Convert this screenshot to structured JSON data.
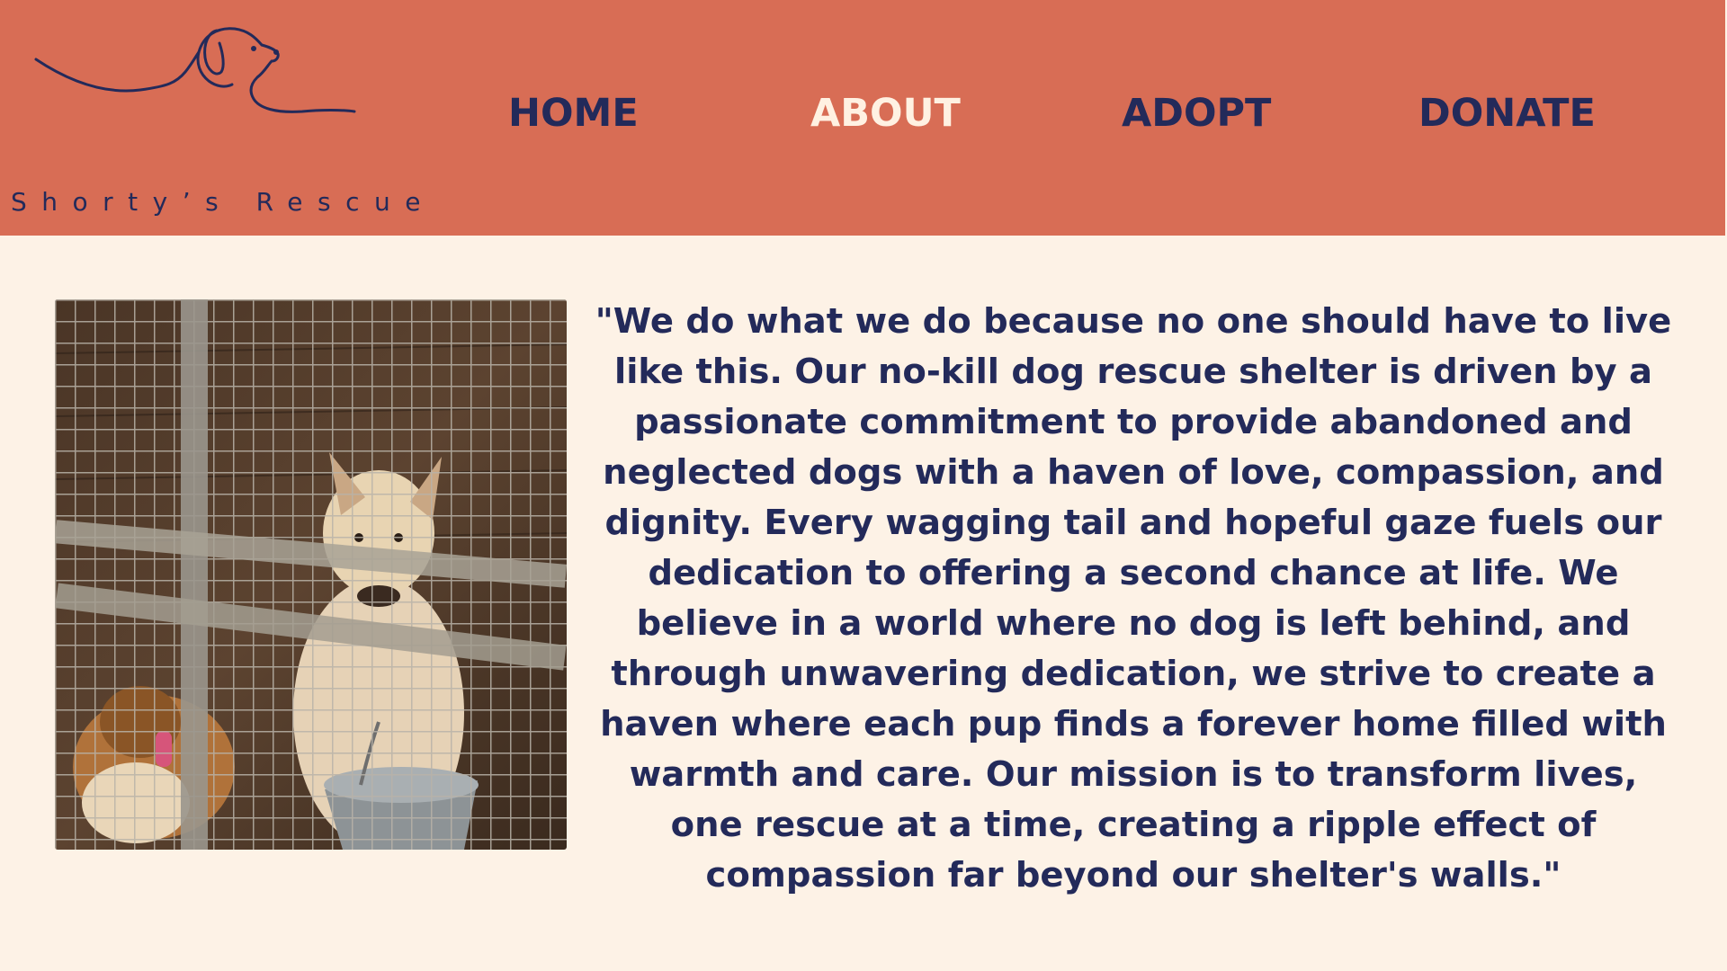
{
  "brand": {
    "name": "Shorty’s Rescue",
    "logo_icon": "dog-line-drawing-icon"
  },
  "nav": {
    "items": [
      {
        "label": "HOME",
        "active": false
      },
      {
        "label": "ABOUT",
        "active": true
      },
      {
        "label": "ADOPT",
        "active": false
      },
      {
        "label": "DONATE",
        "active": false
      }
    ]
  },
  "main": {
    "photo_subject": "dogs-in-kennel-photo",
    "quote": "\"We do what we do because no one should have to live like this. Our no-kill dog rescue shelter is driven by a passionate commitment to provide abandoned and neglected dogs with a haven of love, compassion, and dignity. Every wagging tail and hopeful gaze fuels our dedication to offering a second chance at life. We believe in a world where no dog is left behind, and through unwavering dedication, we strive to create a haven where each pup finds a forever home filled with warmth and care. Our mission is to transform lives, one rescue at a time, creating a ripple effect of compassion far beyond our shelter's walls.\""
  },
  "colors": {
    "header_bg": "#d86d55",
    "page_bg": "#fdf2e6",
    "text_navy": "#232a5a",
    "active_nav": "#fff1e2"
  }
}
